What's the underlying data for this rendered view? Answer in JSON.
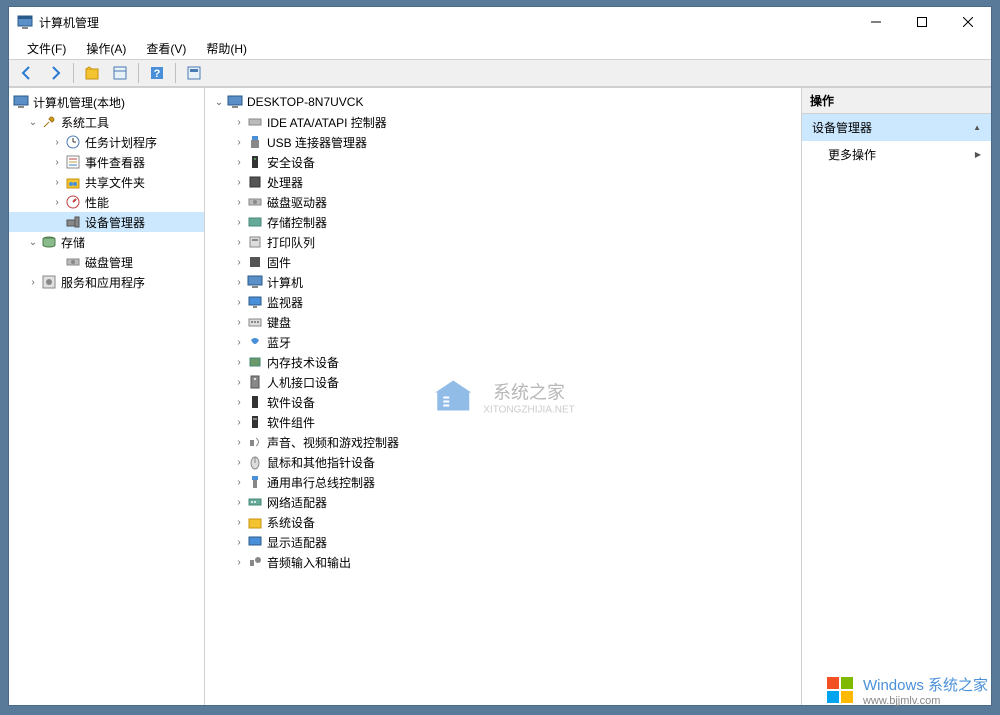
{
  "window": {
    "title": "计算机管理"
  },
  "menu": {
    "file": "文件(F)",
    "action": "操作(A)",
    "view": "查看(V)",
    "help": "帮助(H)"
  },
  "left_tree": {
    "root": "计算机管理(本地)",
    "system_tools": "系统工具",
    "task_scheduler": "任务计划程序",
    "event_viewer": "事件查看器",
    "shared_folders": "共享文件夹",
    "performance": "性能",
    "device_manager": "设备管理器",
    "storage": "存储",
    "disk_management": "磁盘管理",
    "services_apps": "服务和应用程序"
  },
  "center_tree": {
    "computer_name": "DESKTOP-8N7UVCK",
    "items": [
      "IDE ATA/ATAPI 控制器",
      "USB 连接器管理器",
      "安全设备",
      "处理器",
      "磁盘驱动器",
      "存储控制器",
      "打印队列",
      "固件",
      "计算机",
      "监视器",
      "键盘",
      "蓝牙",
      "内存技术设备",
      "人机接口设备",
      "软件设备",
      "软件组件",
      "声音、视频和游戏控制器",
      "鼠标和其他指针设备",
      "通用串行总线控制器",
      "网络适配器",
      "系统设备",
      "显示适配器",
      "音频输入和输出"
    ]
  },
  "right_panel": {
    "header": "操作",
    "device_manager": "设备管理器",
    "more_actions": "更多操作"
  },
  "watermark": {
    "name": "系统之家",
    "url": "XITONGZHIJIA.NET"
  },
  "brand": {
    "text": "Windows 系统之家",
    "url": "www.bjjmlv.com"
  }
}
